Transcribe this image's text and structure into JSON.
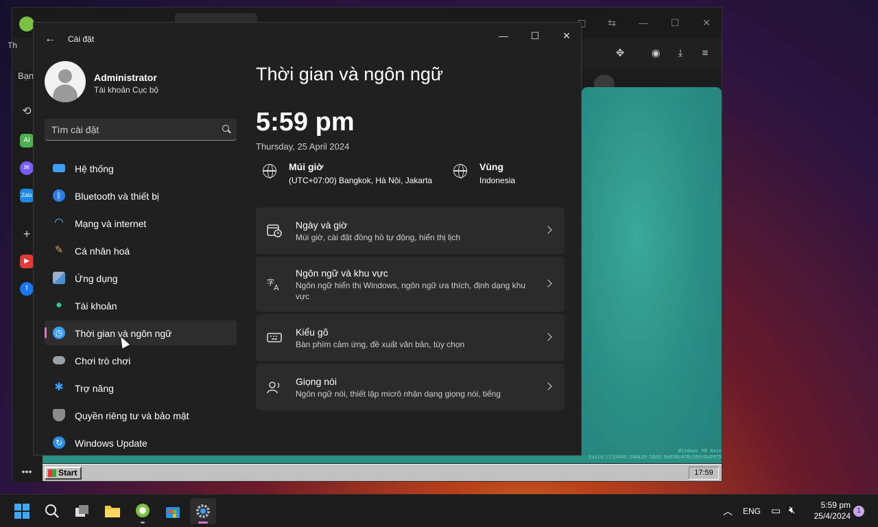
{
  "background_browser": {
    "fragments": [
      "Th",
      "Bạn",
      "C"
    ],
    "sidebar_icons": [
      "history-icon",
      "ai-icon",
      "messenger-icon",
      "zalo-icon",
      "add-icon",
      "youtube-icon",
      "facebook-icon",
      "more-icon"
    ],
    "sidebar_ai_label": "AI",
    "sidebar_zalo_label": "Zalo",
    "emulator_note": "Windows 98 main",
    "emulator_hash": "build.cf13448.248410-1828.0a638cA76c19fc6a2975",
    "w98_start_label": "Start",
    "w98_clock": "17:59"
  },
  "settings": {
    "window_title": "Cài đặt",
    "profile": {
      "name": "Administrator",
      "account_type": "Tài khoản Cục bộ"
    },
    "search": {
      "placeholder": "Tìm cài đặt"
    },
    "nav": [
      {
        "label": "Hệ thống",
        "icon": "system-icon",
        "color": "#3aa0ff"
      },
      {
        "label": "Bluetooth và thiết bị",
        "icon": "bluetooth-icon",
        "color": "#2b7ee8"
      },
      {
        "label": "Mạng và internet",
        "icon": "wifi-icon",
        "color": "#4cb3ff"
      },
      {
        "label": "Cá nhân hoá",
        "icon": "brush-icon",
        "color": "#d9a066"
      },
      {
        "label": "Ứng dụng",
        "icon": "apps-icon",
        "color": "#7a8ea8"
      },
      {
        "label": "Tài khoản",
        "icon": "account-icon",
        "color": "#2ec4a0"
      },
      {
        "label": "Thời gian và ngôn ngữ",
        "icon": "time-language-icon",
        "color": "#3aa0ff",
        "selected": true
      },
      {
        "label": "Chơi trò chơi",
        "icon": "gamepad-icon",
        "color": "#9aa0a6"
      },
      {
        "label": "Trợ năng",
        "icon": "accessibility-icon",
        "color": "#3aa0ff"
      },
      {
        "label": "Quyền riêng tư và bảo mật",
        "icon": "shield-icon",
        "color": "#8c8c8c"
      },
      {
        "label": "Windows Update",
        "icon": "update-icon",
        "color": "#2b8fe8"
      }
    ],
    "main": {
      "page_title": "Thời gian và ngôn ngữ",
      "time": "5:59 pm",
      "date": "Thursday, 25 April 2024",
      "timezone": {
        "title": "Múi giờ",
        "value": "(UTC+07:00) Bangkok, Hà Nội, Jakarta"
      },
      "region": {
        "title": "Vùng",
        "value": "Indonesia"
      },
      "cards": [
        {
          "title": "Ngày và giờ",
          "desc": "Múi giờ, cài đặt đồng hồ tự động, hiển thị lịch",
          "icon": "calendar-clock-icon"
        },
        {
          "title": "Ngôn ngữ và khu vực",
          "desc": "Ngôn ngữ hiển thị Windows, ngôn ngữ ưa thích, định dạng khu vực",
          "icon": "language-icon"
        },
        {
          "title": "Kiểu gõ",
          "desc": "Bàn phím cảm ứng, đề xuất văn bản, tùy chọn",
          "icon": "keyboard-icon"
        },
        {
          "title": "Giọng nói",
          "desc": "Ngôn ngữ nói, thiết lập micrô nhận dạng giọng nói, tiếng",
          "icon": "speech-icon"
        }
      ]
    }
  },
  "taskbar": {
    "apps": [
      "start-icon",
      "search-icon",
      "task-view-icon",
      "file-explorer-icon",
      "coc-coc-browser-icon",
      "microsoft-store-icon",
      "settings-icon"
    ],
    "language": "ENG",
    "time": "5:59 pm",
    "date": "25/4/2024",
    "notifications": "1"
  },
  "colors": {
    "accent": "#e06fc6",
    "window_bg": "#202020",
    "card_bg": "#2b2b2b"
  }
}
